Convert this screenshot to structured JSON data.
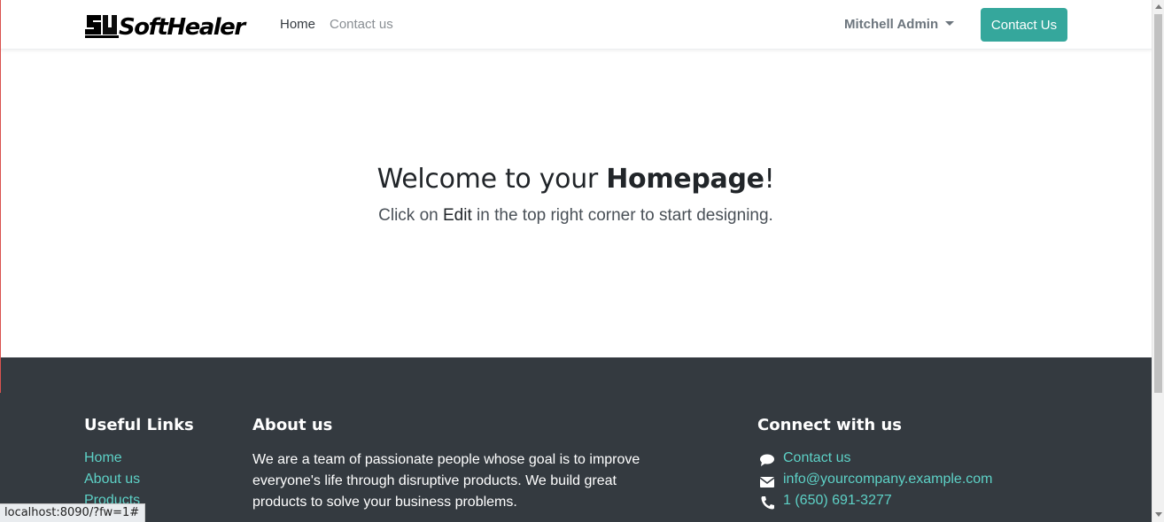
{
  "header": {
    "logo_alt": "SoftHealer",
    "nav": [
      {
        "label": "Home"
      },
      {
        "label": "Contact us"
      }
    ],
    "user_name": "Mitchell Admin",
    "cta_label": "Contact Us"
  },
  "hero": {
    "title_pre": "Welcome to your ",
    "title_bold": "Homepage",
    "title_post": "!",
    "sub_pre": "Click on ",
    "sub_bold": "Edit",
    "sub_post": " in the top right corner to start designing."
  },
  "footer": {
    "useful_links": {
      "heading": "Useful Links",
      "items": [
        "Home",
        "About us",
        "Products"
      ]
    },
    "about": {
      "heading": "About us",
      "text": "We are a team of passionate people whose goal is to improve everyone's life through disruptive products. We build great products to solve your business problems."
    },
    "connect": {
      "heading": "Connect with us",
      "items": [
        {
          "icon": "comment-icon",
          "label": "Contact us"
        },
        {
          "icon": "envelope-icon",
          "label": "info@yourcompany.example.com"
        },
        {
          "icon": "phone-icon",
          "label": "1 (650) 691-3277"
        }
      ]
    }
  },
  "status_bar": {
    "url": "localhost:8090/?fw=1#"
  },
  "colors": {
    "accent": "#35a79c",
    "footer_bg": "#343a40",
    "footer_link": "#5dd1c6"
  }
}
